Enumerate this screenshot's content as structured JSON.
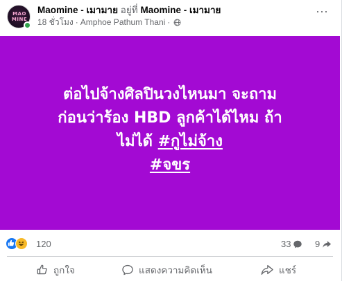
{
  "post": {
    "author": "Maomine - เมามาย",
    "connector": "อยู่ที่",
    "location_page": "Maomine - เมามาย",
    "time": "18 ชั่วโมง",
    "place": "Amphoe Pathum Thani",
    "separator": "·",
    "avatar_text_1": "MAO",
    "avatar_text_2": "MINE",
    "more_icon_label": "···",
    "background_color": "#a30ad3",
    "text_lines": [
      "ต่อไปจ้างศิลปินวงไหนมา จะถาม",
      "ก่อนว่าร้อง HBD ลูกค้าได้ไหม ถ้า"
    ],
    "line3_prefix": "ไม่ได้ ",
    "hashtag1": "#กูไม่จ้าง",
    "hashtag2": "#จขร"
  },
  "stats": {
    "reactions": "120",
    "comments": "33",
    "shares": "9"
  },
  "actions": {
    "like": "ถูกใจ",
    "comment": "แสดงความคิดเห็น",
    "share": "แชร์"
  },
  "icons": {
    "reaction_1": "like-reaction-icon",
    "reaction_2": "haha-reaction-icon",
    "privacy": "globe-icon",
    "comment_count": "comment-bubble-icon",
    "share_count": "share-arrow-icon"
  }
}
